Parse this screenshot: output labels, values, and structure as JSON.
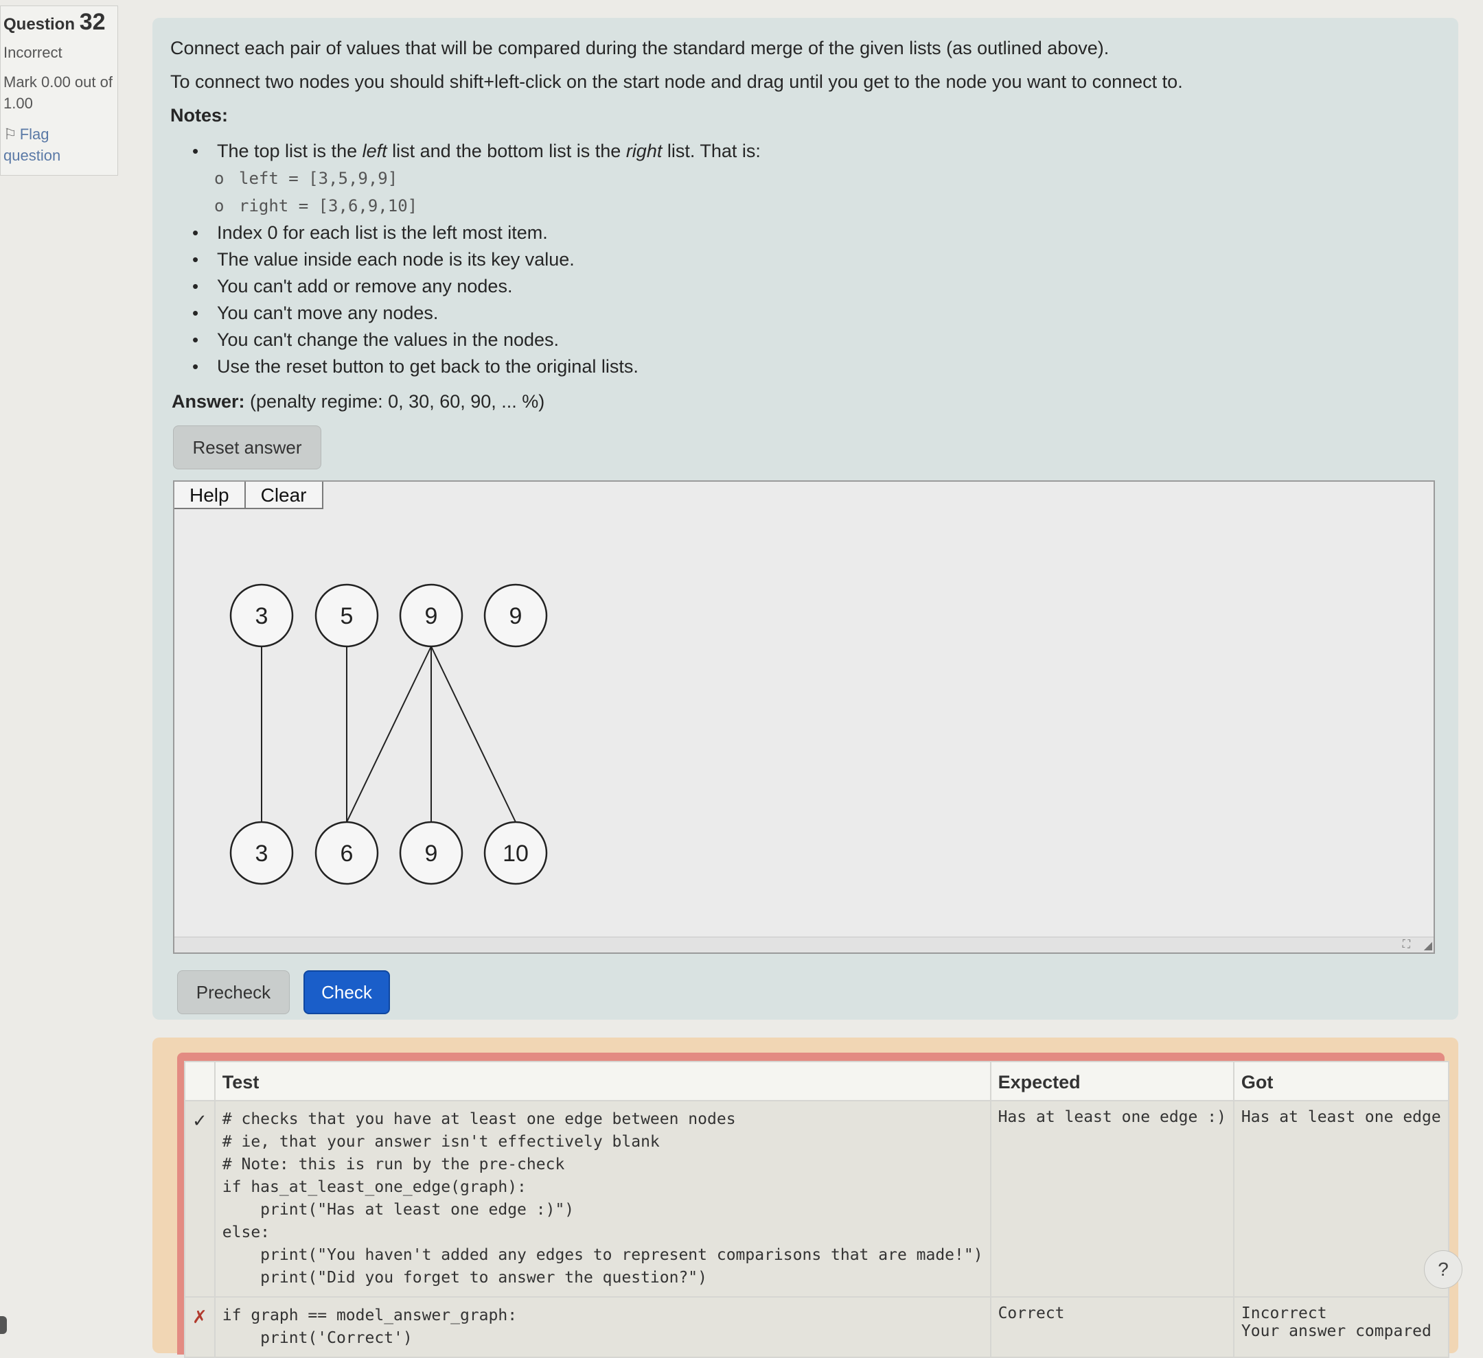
{
  "info": {
    "question_label": "Question",
    "question_number": "32",
    "state": "Incorrect",
    "mark": "Mark 0.00 out of 1.00",
    "flag_label": "Flag question"
  },
  "question": {
    "line1": "Connect each pair of values that will be compared during the standard merge of the given lists (as outlined above).",
    "line2": "To connect two nodes you should shift+left-click on the start node and drag until you get to the node you want to connect to.",
    "notes_heading": "Notes:",
    "note1_a": "The top list is the ",
    "note1_em1": "left",
    "note1_b": " list and the bottom list is the ",
    "note1_em2": "right",
    "note1_c": " list. That is:",
    "code_left": "left = [3,5,9,9]",
    "code_right": "right = [3,6,9,10]",
    "note2": "Index 0 for each list is the left most item.",
    "note3": "The value inside each node is its key value.",
    "note4": "You can't add or remove any nodes.",
    "note5": "You can't move any nodes.",
    "note6": "You can't change the values in the nodes.",
    "note7": "Use the reset button to get back to the original lists."
  },
  "answer": {
    "label": "Answer:",
    "penalty": "(penalty regime: 0, 30, 60, 90, ... %)",
    "reset_label": "Reset answer"
  },
  "editor": {
    "help_label": "Help",
    "clear_label": "Clear",
    "fullscreen_icon": "fullscreen-icon",
    "resize_icon": "resize-handle-icon"
  },
  "graph": {
    "top_nodes": [
      "3",
      "5",
      "9",
      "9"
    ],
    "bottom_nodes": [
      "3",
      "6",
      "9",
      "10"
    ],
    "edges": [
      [
        0,
        0
      ],
      [
        1,
        1
      ],
      [
        2,
        1
      ],
      [
        2,
        2
      ],
      [
        2,
        3
      ]
    ]
  },
  "buttons": {
    "precheck_label": "Precheck",
    "check_label": "Check"
  },
  "results": {
    "headers": {
      "test": "Test",
      "expected": "Expected",
      "got": "Got"
    },
    "row1": {
      "status": "✓",
      "code": "# checks that you have at least one edge between nodes\n# ie, that your answer isn't effectively blank\n# Note: this is run by the pre-check\nif has_at_least_one_edge(graph):\n    print(\"Has at least one edge :)\")\nelse:\n    print(\"You haven't added any edges to represent comparisons that are made!\")\n    print(\"Did you forget to answer the question?\")",
      "expected": "Has at least one edge :)",
      "got": "Has at least one edge"
    },
    "row2": {
      "status": "✗",
      "code": "if graph == model_answer_graph:\n    print('Correct')",
      "expected": "Correct",
      "got": "Incorrect\nYour answer compared"
    }
  },
  "help_fab": "?"
}
